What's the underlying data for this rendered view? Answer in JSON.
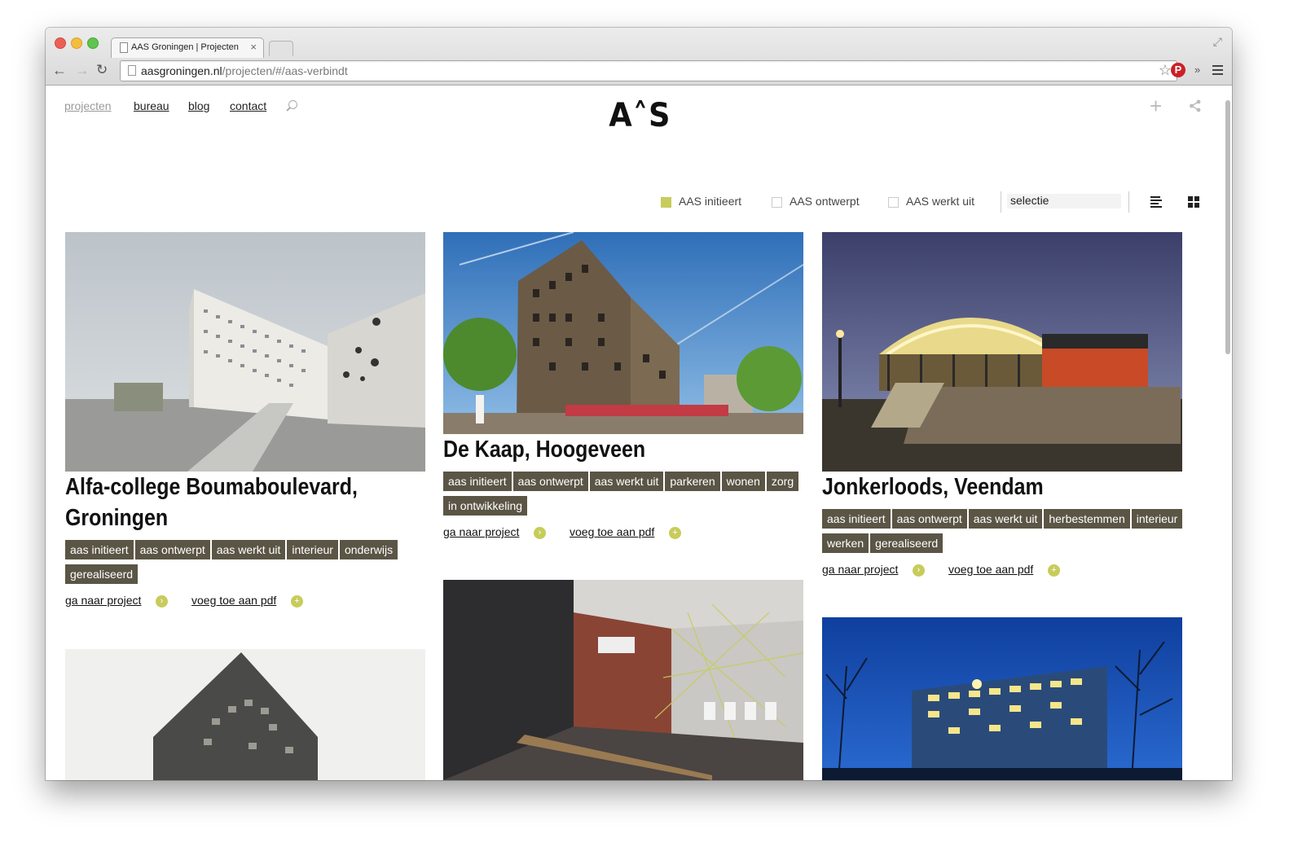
{
  "browser": {
    "tab_title": "AAS Groningen | Projecten",
    "tab_close": "×",
    "url_host": "aasgroningen.nl",
    "url_path": "/projecten/#/aas-verbindt",
    "back": "←",
    "forward": "→",
    "reload": "↻",
    "star": "☆",
    "pinterest": "P",
    "extensions": "»",
    "fullscreen": "⤢"
  },
  "nav": {
    "projecten": "projecten",
    "bureau": "bureau",
    "blog": "blog",
    "contact": "contact"
  },
  "logo": "A˄S",
  "actions": {
    "plus": "+"
  },
  "filters": {
    "initieert": "AAS initieert",
    "ontwerpt": "AAS ontwerpt",
    "werkt_uit": "AAS werkt uit",
    "selectie": "selectie"
  },
  "colors": {
    "accent": "#c7cc5a",
    "tag_bg": "#5b5546"
  },
  "projects": [
    {
      "title": "Alfa-college Boumaboulevard,",
      "title2": "Groningen",
      "tags": [
        "aas initieert",
        "aas ontwerpt",
        "aas werkt uit",
        "interieur",
        "onderwijs",
        "gerealiseerd"
      ],
      "link_project": "ga naar project",
      "link_pdf": "voeg toe aan pdf"
    },
    {
      "title": "De Kaap, Hoogeveen",
      "tags": [
        "aas initieert",
        "aas ontwerpt",
        "aas werkt uit",
        "parkeren",
        "wonen",
        "zorg",
        "in ontwikkeling"
      ],
      "link_project": "ga naar project",
      "link_pdf": "voeg toe aan pdf"
    },
    {
      "title": "Jonkerloods, Veendam",
      "tags": [
        "aas initieert",
        "aas ontwerpt",
        "aas werkt uit",
        "herbestemmen",
        "interieur",
        "werken",
        "gerealiseerd"
      ],
      "link_project": "ga naar project",
      "link_pdf": "voeg toe aan pdf"
    }
  ],
  "icons": {
    "arrow": "›",
    "plus": "+"
  }
}
